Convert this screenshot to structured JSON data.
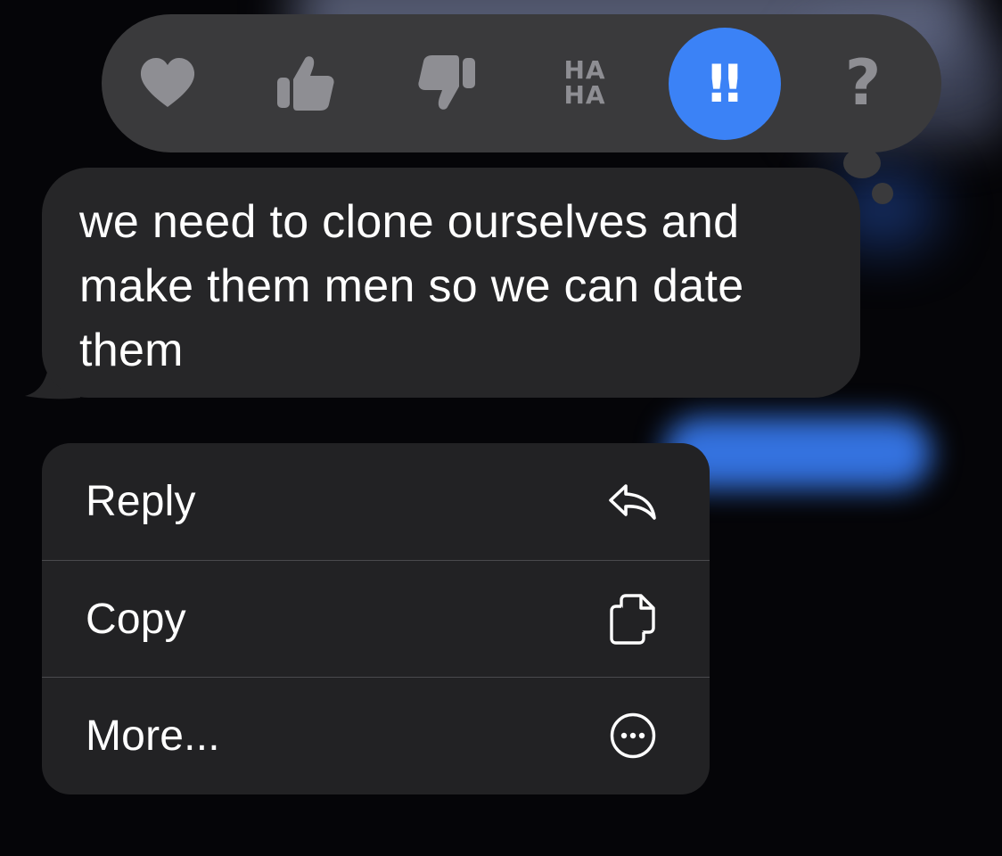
{
  "tapbacks": [
    {
      "name": "heart",
      "icon": "heart-icon",
      "selected": false
    },
    {
      "name": "like",
      "icon": "thumbs-up-icon",
      "selected": false
    },
    {
      "name": "dislike",
      "icon": "thumbs-down-icon",
      "selected": false
    },
    {
      "name": "laugh",
      "icon": "haha-icon",
      "label_line1": "HA",
      "label_line2": "HA",
      "selected": false
    },
    {
      "name": "emphasize",
      "icon": "double-exclamation-icon",
      "label": "!!",
      "selected": true
    },
    {
      "name": "question",
      "icon": "question-icon",
      "label": "?",
      "selected": false
    }
  ],
  "message": {
    "text": "we need to clone ourselves and make them men so we can date them"
  },
  "menu": {
    "items": [
      {
        "label": "Reply",
        "icon": "reply-arrow-icon"
      },
      {
        "label": "Copy",
        "icon": "copy-documents-icon"
      },
      {
        "label": "More...",
        "icon": "ellipsis-circle-icon"
      }
    ]
  },
  "colors": {
    "background": "#050508",
    "tapback_bar": "#3a3a3c",
    "tapback_icon": "#8e8e93",
    "selected_tapback": "#3b82f6",
    "bubble": "#262628",
    "menu": "#222224",
    "text": "#ffffff"
  }
}
